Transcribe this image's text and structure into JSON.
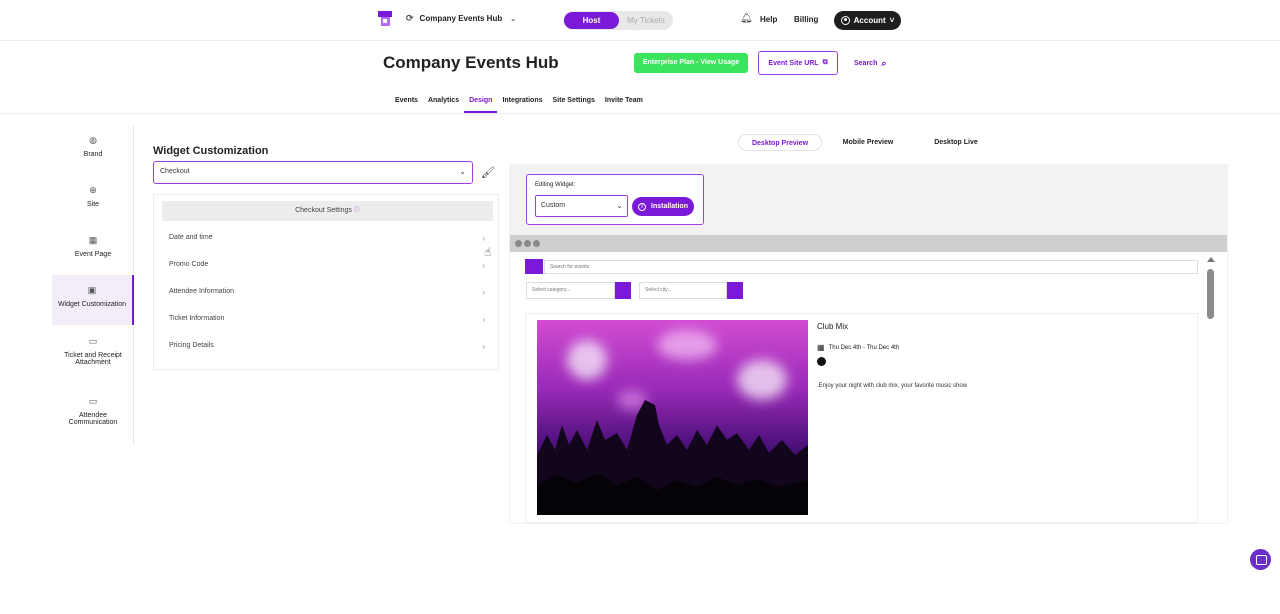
{
  "topbar": {
    "org_name": "Company Events Hub",
    "mode_active": "Host",
    "mode_inactive": "My Tickets",
    "help": "Help",
    "billing": "Billing",
    "account": "Account"
  },
  "header": {
    "title": "Company Events Hub",
    "plan_button": "Enterprise Plan - View Usage",
    "site_url_button": "Event Site URL",
    "search_link": "Search"
  },
  "nav": {
    "tabs": [
      "Events",
      "Analytics",
      "Design",
      "Integrations",
      "Site Settings",
      "Invite Team"
    ],
    "active": "Design"
  },
  "sidebar": {
    "items": [
      {
        "label": "Brand",
        "icon": "palette-icon"
      },
      {
        "label": "Site",
        "icon": "globe-icon"
      },
      {
        "label": "Event Page",
        "icon": "calendar-icon"
      },
      {
        "label": "Widget Customization",
        "icon": "widget-icon"
      },
      {
        "label": "Ticket and Receipt Attachment",
        "icon": "attachment-icon"
      },
      {
        "label": "Attendee Communication",
        "icon": "mail-icon"
      }
    ],
    "active": "Widget Customization"
  },
  "widget_customization": {
    "title": "Widget Customization",
    "selected": "Checkout",
    "settings_title": "Checkout Settings",
    "rows": [
      "Date and time",
      "Promo Code",
      "Attendee Information",
      "Ticket Information",
      "Pricing Details"
    ]
  },
  "preview_tabs": {
    "tabs": [
      "Desktop Preview",
      "Mobile Preview",
      "Desktop Live"
    ],
    "active": "Desktop Preview"
  },
  "editing": {
    "label": "Editing Widget:",
    "selected": "Custom",
    "install_button": "Installation"
  },
  "widget_preview": {
    "search_placeholder": "Search for events",
    "category_placeholder": "Select category...",
    "city_placeholder": "Select city...",
    "event": {
      "title": "Club Mix",
      "date": "Thu Dec 4th - Thu Dec 4th",
      "description": ".Enjoy your night with club mix, your favorite music show"
    }
  },
  "colors": {
    "accent": "#7b19d8",
    "plan_green": "#38e55c"
  }
}
